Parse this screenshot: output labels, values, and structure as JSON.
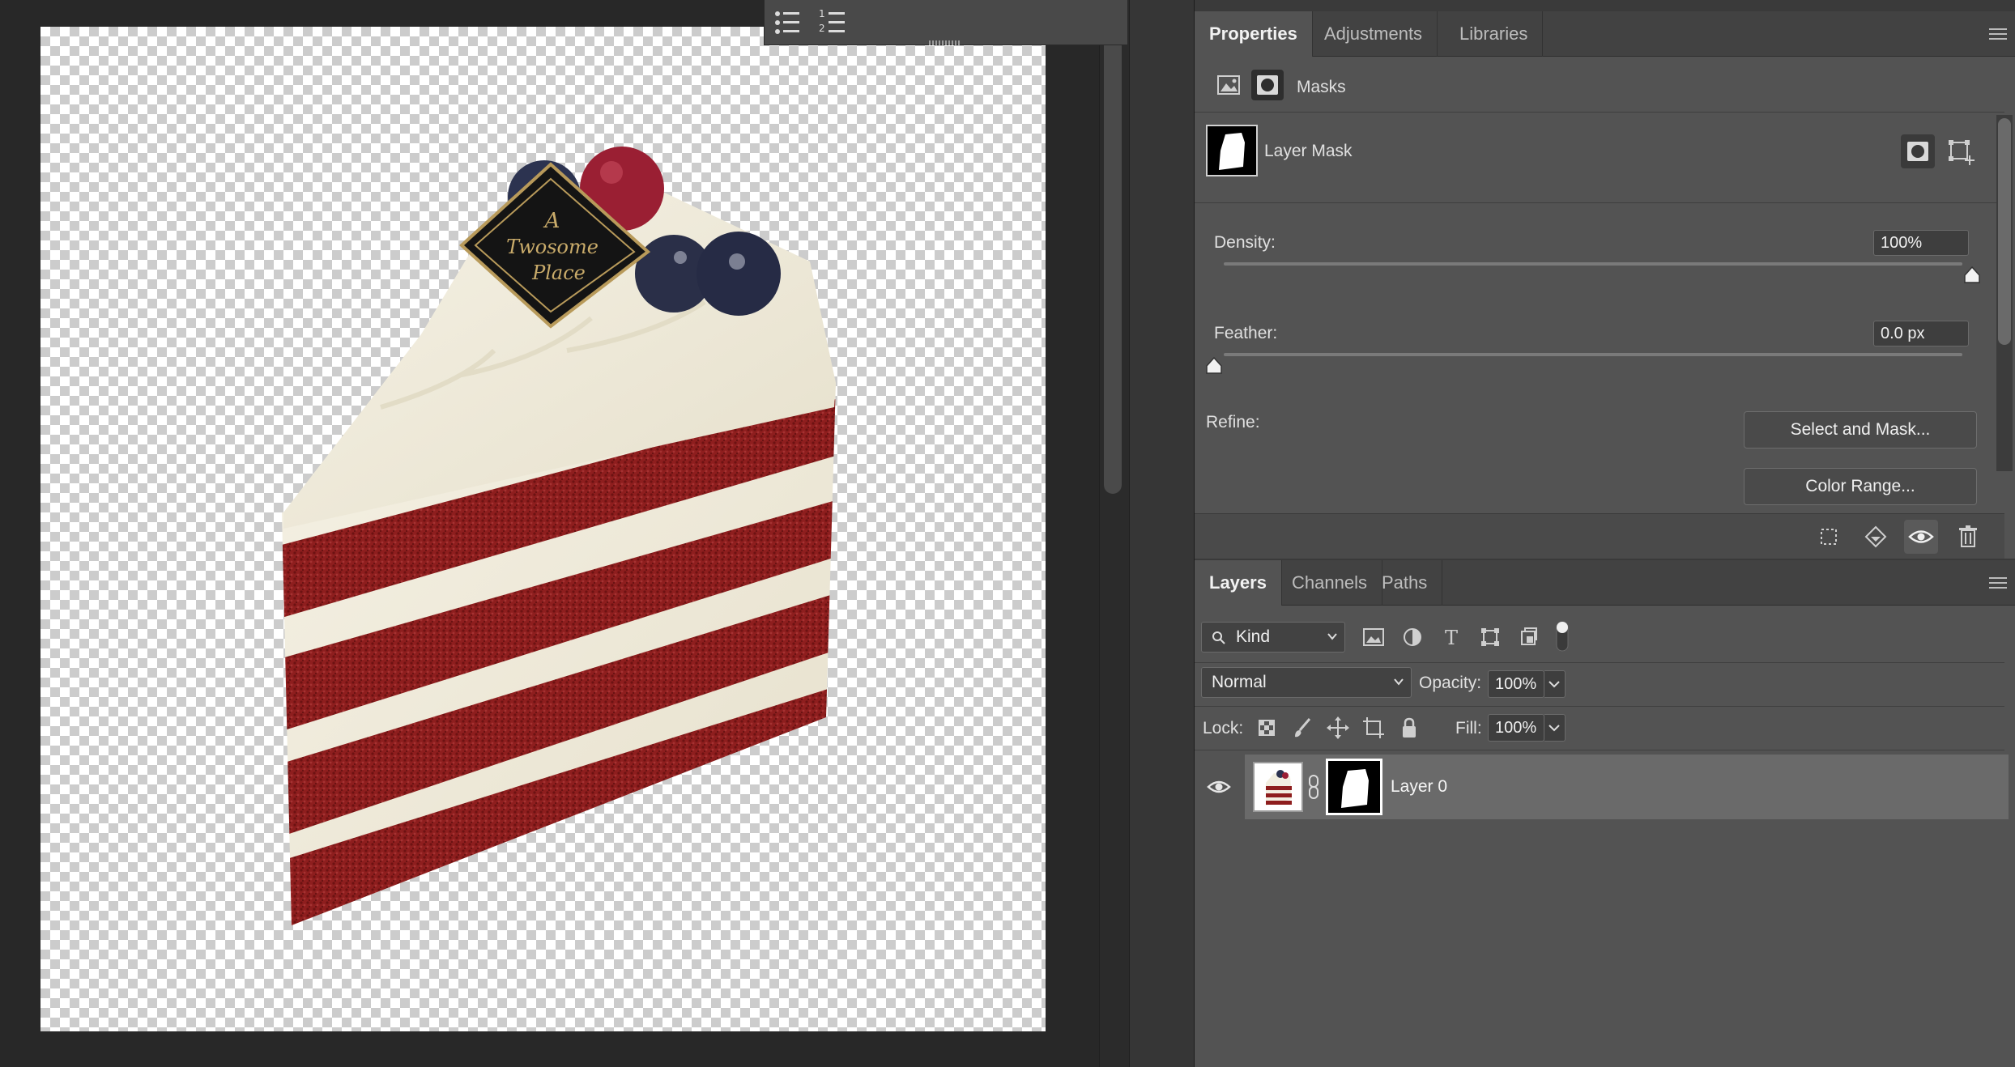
{
  "floating_toolbar": {
    "bulleted_list_icon": "bulleted-list-icon",
    "numbered_list_icon": "numbered-list-icon"
  },
  "canvas": {
    "cake_topper_lines": [
      "A",
      "Twosome",
      "Place"
    ]
  },
  "properties_panel": {
    "tabs": [
      "Properties",
      "Adjustments",
      "Libraries"
    ],
    "active_tab": "Properties",
    "section_title": "Masks",
    "mask_label": "Layer Mask",
    "density": {
      "label": "Density:",
      "value": "100%",
      "level": 1.0
    },
    "feather": {
      "label": "Feather:",
      "value": "0.0 px",
      "level": 0.0
    },
    "refine_label": "Refine:",
    "select_and_mask_label": "Select and Mask...",
    "color_range_label": "Color Range..."
  },
  "layers_panel": {
    "tabs": [
      "Layers",
      "Channels",
      "Paths"
    ],
    "active_tab": "Layers",
    "filter_kind": "Kind",
    "blend_mode": "Normal",
    "opacity_label": "Opacity:",
    "opacity_value": "100%",
    "lock_label": "Lock:",
    "fill_label": "Fill:",
    "fill_value": "100%",
    "layers": [
      {
        "name": "Layer 0",
        "visible": true,
        "has_mask": true,
        "selected": true
      }
    ]
  },
  "colors": {
    "panel_bg": "#535353",
    "tabbar_bg": "#424242",
    "selected_layer_bg": "#6a6a6a",
    "canvas_bg": "#282828"
  }
}
